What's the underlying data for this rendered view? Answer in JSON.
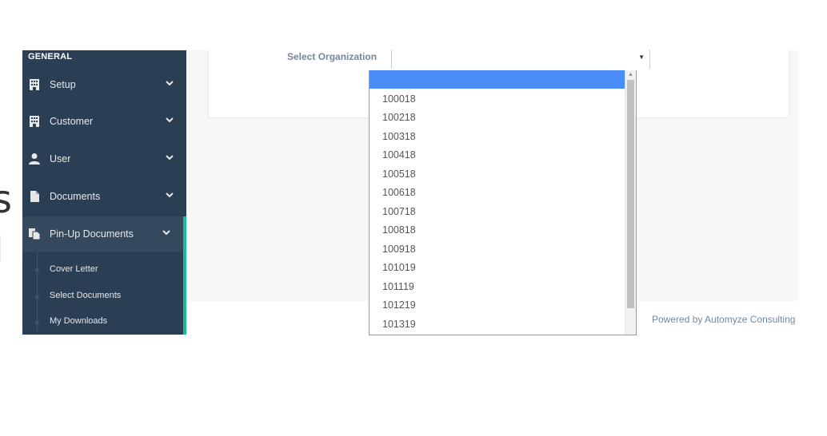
{
  "sidebar": {
    "section_title": "GENERAL",
    "items": [
      {
        "label": "Setup",
        "icon": "building-icon"
      },
      {
        "label": "Customer",
        "icon": "building-icon"
      },
      {
        "label": "User",
        "icon": "user-icon"
      },
      {
        "label": "Documents",
        "icon": "document-icon"
      },
      {
        "label": "Pin-Up Documents",
        "icon": "copy-documents-icon",
        "active": true
      }
    ],
    "children": [
      {
        "label": "Cover Letter"
      },
      {
        "label": "Select Documents"
      },
      {
        "label": "My Downloads"
      }
    ]
  },
  "form": {
    "org_label": "Select Organization",
    "selected_value": "",
    "options": [
      "",
      "100018",
      "100218",
      "100318",
      "100418",
      "100518",
      "100618",
      "100718",
      "100818",
      "100918",
      "101019",
      "101119",
      "101219",
      "101319"
    ]
  },
  "footer": {
    "text": "Powered by Automyze Consulting"
  },
  "edge_glyphs": [
    "s",
    "l"
  ],
  "colors": {
    "sidebar_bg": "#2a3f54",
    "active_accent": "#1abb9c",
    "selected_option": "#4a8df8",
    "muted_text": "#73879c"
  }
}
